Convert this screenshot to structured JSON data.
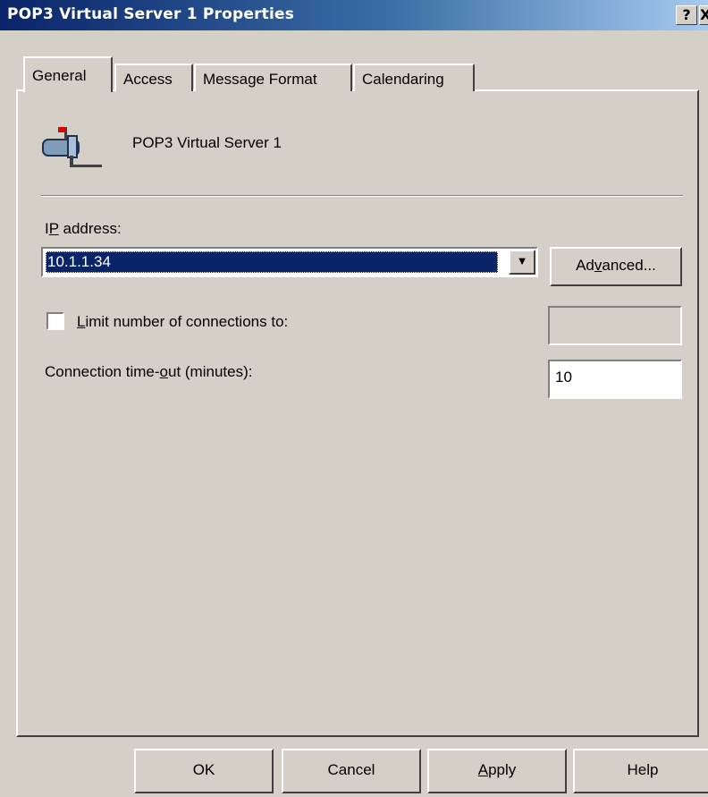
{
  "window": {
    "title": "POP3 Virtual Server 1 Properties",
    "help_glyph": "?",
    "close_glyph": "X"
  },
  "tabs": [
    {
      "label": "General",
      "active": true
    },
    {
      "label": "Access",
      "active": false
    },
    {
      "label": "Message Format",
      "active": false
    },
    {
      "label": "Calendaring",
      "active": false
    }
  ],
  "general": {
    "icon": "mailbox-icon",
    "server_name": "POP3 Virtual Server 1",
    "ip_label_mnemonic": "P",
    "ip_label_pre": "I",
    "ip_label_post": " address:",
    "ip_value": "10.1.1.34",
    "advanced_pre": "Ad",
    "advanced_mnemonic": "v",
    "advanced_post": "anced...",
    "limit_checked": false,
    "limit_mnemonic": "L",
    "limit_post": "imit number of connections to:",
    "limit_value": "",
    "timeout_pre": "Connection time-",
    "timeout_mnemonic": "o",
    "timeout_post": "ut (minutes):",
    "timeout_value": "10"
  },
  "buttons": {
    "ok": "OK",
    "cancel": "Cancel",
    "apply_mnemonic": "A",
    "apply_post": "pply",
    "help": "Help"
  },
  "colors": {
    "titlebar_start": "#0a246a",
    "titlebar_end": "#a6caf0",
    "face": "#d4d0c8",
    "selection": "#0a246a"
  }
}
